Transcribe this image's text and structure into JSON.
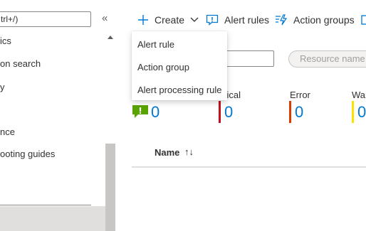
{
  "sidebar": {
    "search_value": "trl+/)",
    "collapse_glyph": "«",
    "items": [
      {
        "label": "ics"
      },
      {
        "label": "on search"
      },
      {
        "label": "y"
      },
      {
        "label": "nce"
      },
      {
        "label": "ooting guides"
      }
    ]
  },
  "toolbar": {
    "create_label": "Create",
    "alert_rules_label": "Alert rules",
    "action_groups_label": "Action groups"
  },
  "create_menu": {
    "items": [
      {
        "label": "Alert rule"
      },
      {
        "label": "Action group"
      },
      {
        "label": "Alert processing rule"
      }
    ]
  },
  "filters": {
    "resource_name_placeholder": "Resource name"
  },
  "severity": [
    {
      "label": "",
      "count": "0",
      "color": "#57a300"
    },
    {
      "label": "itical",
      "count": "0",
      "color": "#c50f1f"
    },
    {
      "label": "Error",
      "count": "0",
      "color": "#da3b01"
    },
    {
      "label": "War",
      "count": "0",
      "color": "#fce100"
    }
  ],
  "table": {
    "columns": [
      {
        "label": "Name",
        "sort_icon": "↑↓"
      }
    ]
  },
  "colors": {
    "accent": "#0078d4",
    "selected_bg": "#e1dfdd"
  }
}
